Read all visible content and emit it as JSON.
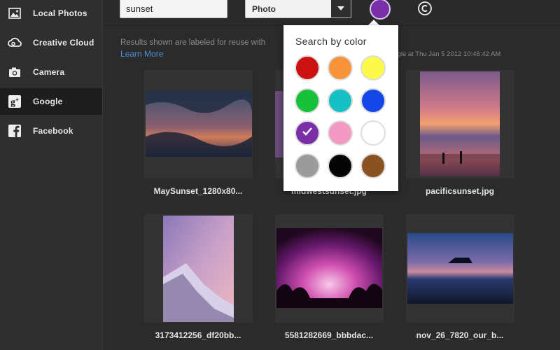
{
  "sidebar": {
    "items": [
      {
        "label": "Local Photos",
        "icon": "image-icon",
        "active": false
      },
      {
        "label": "Creative Cloud",
        "icon": "creative-cloud-icon",
        "active": false
      },
      {
        "label": "Camera",
        "icon": "camera-icon",
        "active": false
      },
      {
        "label": "Google",
        "icon": "google-icon",
        "active": true
      },
      {
        "label": "Facebook",
        "icon": "facebook-icon",
        "active": false
      }
    ]
  },
  "toolbar": {
    "search_value": "sunset",
    "type_selected": "Photo",
    "selected_color": "#7a2ea8",
    "license_icon": "copyright-icon"
  },
  "results": {
    "notice": "Results shown are labeled for reuse with",
    "learn_more": "Learn More",
    "meta": "oogle at Thu Jan 5 2012 10:46:42 AM"
  },
  "thumbnails": [
    {
      "caption": "MaySunset_1280x80..."
    },
    {
      "caption": "midwestsunset.jpg"
    },
    {
      "caption": "pacificsunset.jpg"
    },
    {
      "caption": "3173412256_df20bb..."
    },
    {
      "caption": "5581282669_bbbdac..."
    },
    {
      "caption": "nov_26_7820_our_b..."
    }
  ],
  "color_picker": {
    "title": "Search by color",
    "colors": [
      {
        "name": "red",
        "hex": "#cc1111"
      },
      {
        "name": "orange",
        "hex": "#f7943a"
      },
      {
        "name": "yellow",
        "hex": "#fbf94a"
      },
      {
        "name": "green",
        "hex": "#18c13a"
      },
      {
        "name": "teal",
        "hex": "#15c1c4"
      },
      {
        "name": "blue",
        "hex": "#1546e8"
      },
      {
        "name": "purple",
        "hex": "#7a2ea8",
        "selected": true
      },
      {
        "name": "pink",
        "hex": "#f39ac2"
      },
      {
        "name": "white",
        "hex": "#ffffff"
      },
      {
        "name": "gray",
        "hex": "#9b9b9b"
      },
      {
        "name": "black",
        "hex": "#050505"
      },
      {
        "name": "brown",
        "hex": "#8a5123"
      }
    ]
  }
}
